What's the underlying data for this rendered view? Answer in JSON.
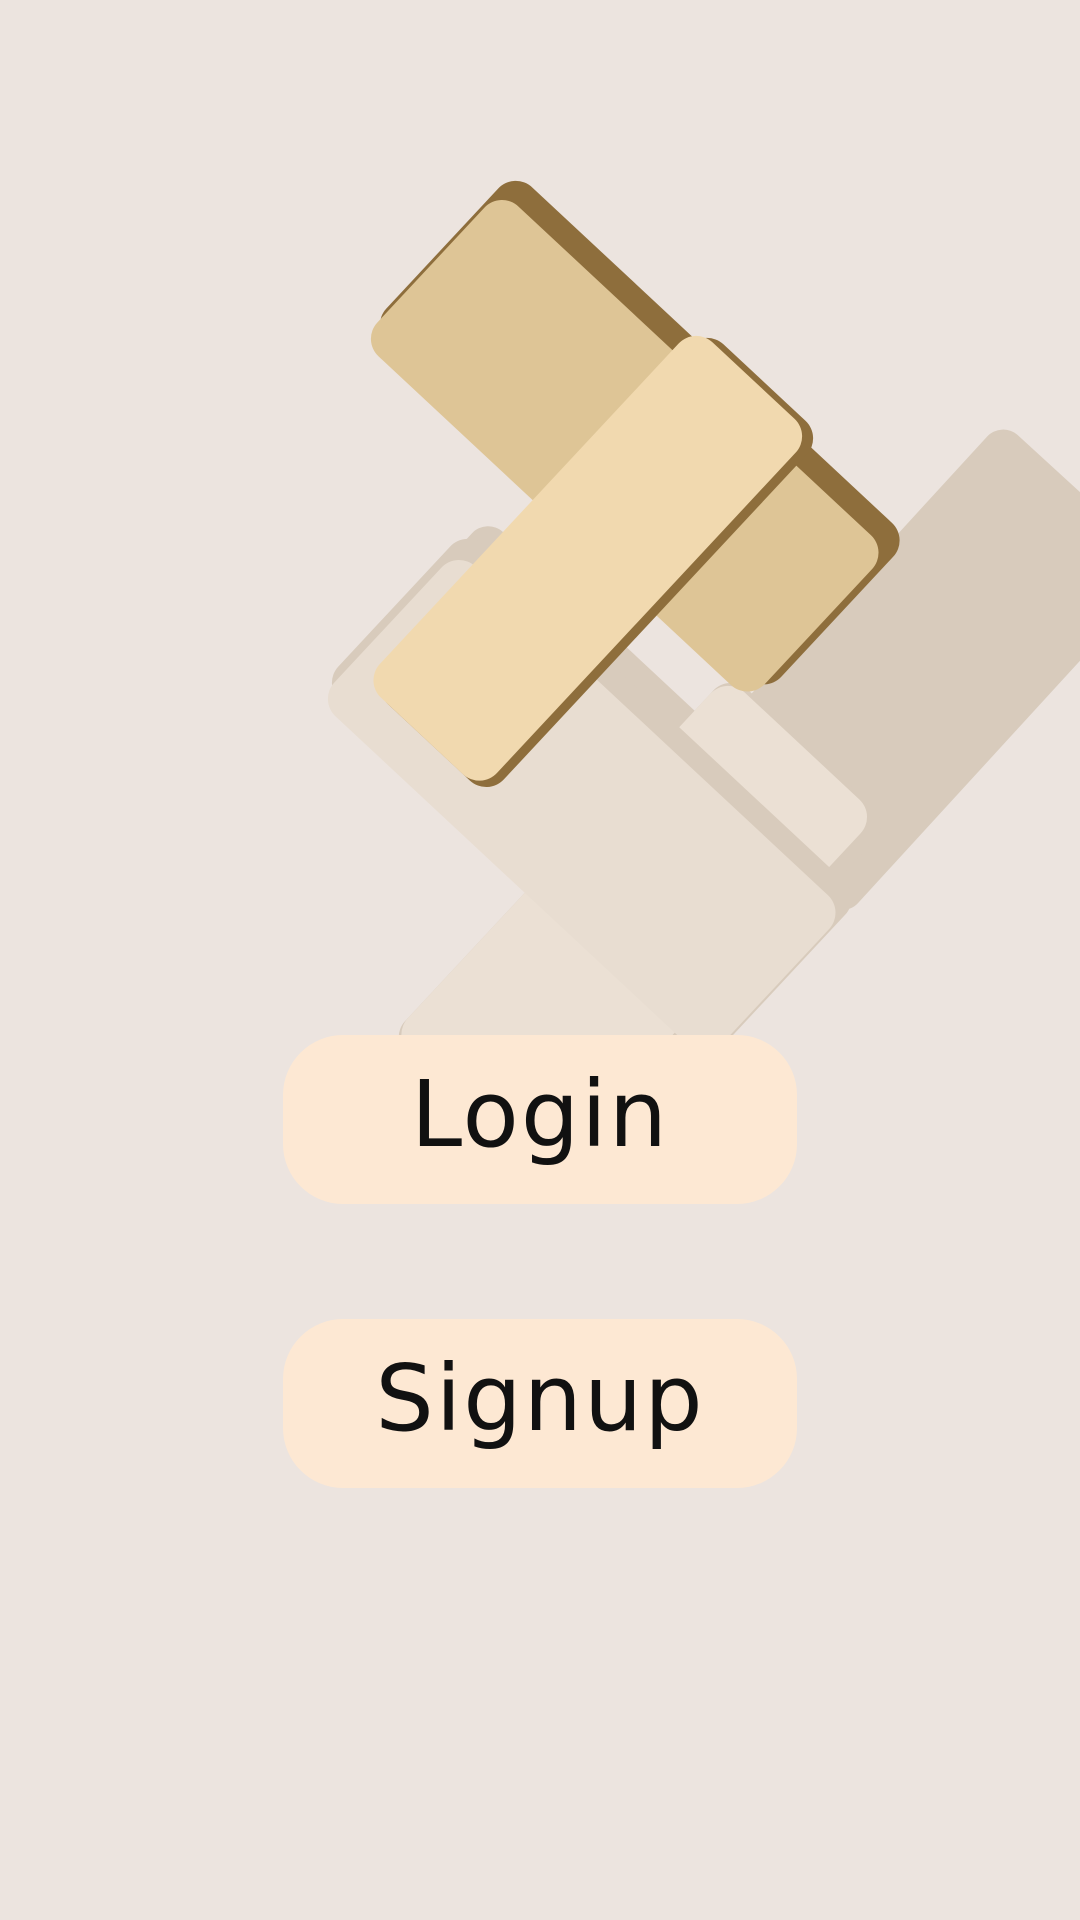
{
  "screen": {
    "background": "#ece4df"
  },
  "logo": {
    "icon": "overlapping-tiles-logo",
    "colors": {
      "tile_left": "#dec596",
      "tile_right": "#f1d9af",
      "tile_shadow": "#8e6e3c",
      "reflection_left": "#e8ddd1",
      "reflection_right": "#ebe0d4",
      "reflection_shadow": "#d8cbbc"
    }
  },
  "buttons": {
    "login_label": "Login",
    "signup_label": "Signup",
    "background": "#fde8d3",
    "text_color": "#111111"
  }
}
